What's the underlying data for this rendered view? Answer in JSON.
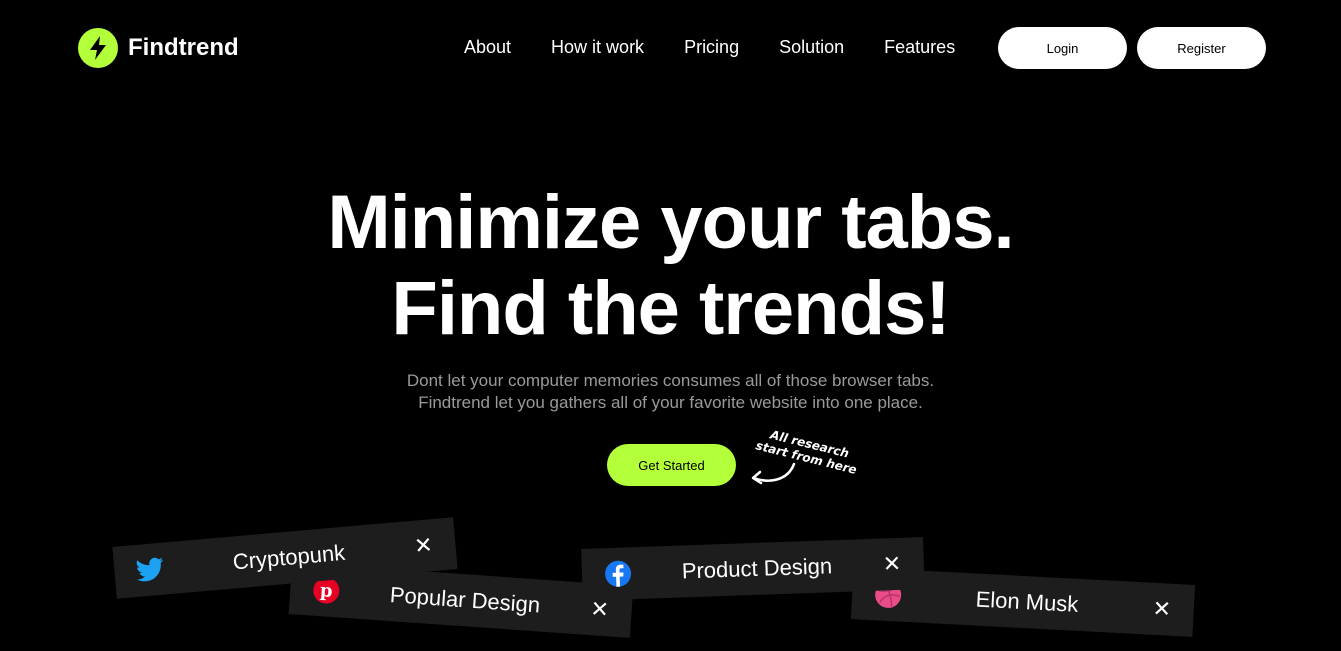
{
  "brand": {
    "name": "Findtrend",
    "accent_color": "#b3ff3a",
    "icon": "lightning-bolt-icon"
  },
  "nav": {
    "items": [
      {
        "label": "About"
      },
      {
        "label": "How it work"
      },
      {
        "label": "Pricing"
      },
      {
        "label": "Solution"
      },
      {
        "label": "Features"
      }
    ],
    "login_label": "Login",
    "register_label": "Register"
  },
  "hero": {
    "title_line1": "Minimize your tabs.",
    "title_line2": "Find the trends!",
    "subtitle_line1": "Dont let your computer memories consumes all of those browser tabs.",
    "subtitle_line2": "Findtrend let you gathers all of your favorite website into one place.",
    "cta_label": "Get Started",
    "annotation_line1": "All research",
    "annotation_line2": "start from here"
  },
  "tabs": [
    {
      "label": "Cryptopunk",
      "icon": "twitter-icon",
      "color": "#1da1f2",
      "close": "✕"
    },
    {
      "label": "Popular Design",
      "icon": "pinterest-icon",
      "color": "#e60023",
      "close": "✕"
    },
    {
      "label": "Product Design",
      "icon": "facebook-icon",
      "color": "#1877f2",
      "close": "✕"
    },
    {
      "label": "Elon Musk",
      "icon": "dribbble-icon",
      "color": "#ea4c89",
      "close": "✕"
    }
  ]
}
